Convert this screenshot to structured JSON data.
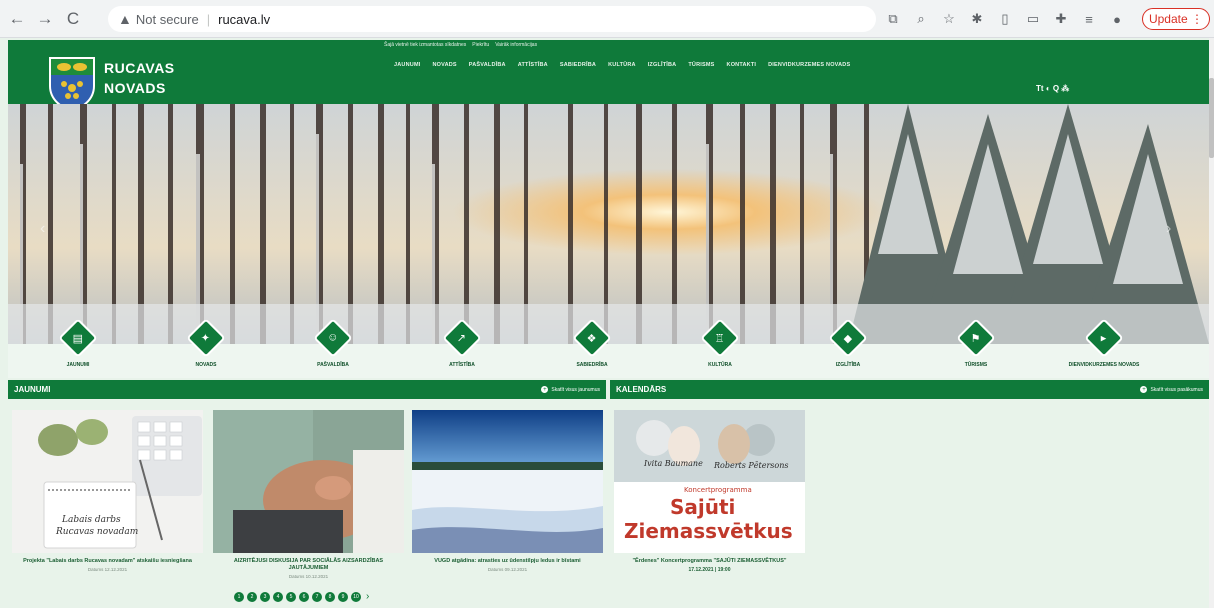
{
  "browser": {
    "security_label": "Not secure",
    "url": "rucava.lv",
    "update_label": "Update"
  },
  "site": {
    "topline": {
      "notice": "Šajā vietnē tiek izmantotas sīkdatnes",
      "accept": "Piekrītu",
      "more": "Vairāk informācijas"
    },
    "brand": {
      "line1": "RUCAVAS",
      "line2": "NOVADS"
    },
    "nav": [
      "JAUNUMI",
      "NOVADS",
      "PAŠVALDĪBA",
      "ATTĪSTĪBA",
      "SABIEDRĪBA",
      "KULTŪRA",
      "IZGLĪTĪBA",
      "TŪRISMS",
      "KONTAKTI",
      "DIENVIDKURZEMES NOVADS"
    ],
    "tools": "Tt ◐ Q ⁂"
  },
  "categories": [
    {
      "label": "JAUNUMI",
      "icon": "newspaper-icon",
      "glyph": "▤"
    },
    {
      "label": "NOVADS",
      "icon": "map-icon",
      "glyph": "✦"
    },
    {
      "label": "PAŠVALDĪBA",
      "icon": "people-icon",
      "glyph": "☺"
    },
    {
      "label": "ATTĪSTĪBA",
      "icon": "growth-icon",
      "glyph": "↗"
    },
    {
      "label": "SABIEDRĪBA",
      "icon": "community-icon",
      "glyph": "❖"
    },
    {
      "label": "KULTŪRA",
      "icon": "lantern-icon",
      "glyph": "♖"
    },
    {
      "label": "IZGLĪTĪBA",
      "icon": "graduation-cap-icon",
      "glyph": "◆"
    },
    {
      "label": "TŪRISMS",
      "icon": "lighthouse-icon",
      "glyph": "⚑"
    },
    {
      "label": "DIENVIDKURZEMES NOVADS",
      "icon": "flag-icon",
      "glyph": "▸"
    }
  ],
  "news": {
    "title": "JAUNUMI",
    "more": "Skatīt visus jaunumus",
    "items": [
      {
        "title": "Projekta \"Labais darbs Rucavas novadam\" atskaišu iesniegšana",
        "date": "Datums 12.12.2021"
      },
      {
        "title": "AIZRITĒJUSI DISKUSIJA PAR SOCIĀLĀS AIZSARDZĪBAS JAUTĀJUMIEM",
        "date": "Datums 10.12.2021"
      },
      {
        "title": "VUGD atgādina: atrasties uz ūdenstilpju ledus ir bīstami",
        "date": "Datums 09.12.2021"
      }
    ],
    "pages": [
      "1",
      "2",
      "3",
      "4",
      "5",
      "6",
      "7",
      "8",
      "9",
      "10"
    ],
    "next": "›"
  },
  "calendar": {
    "title": "KALENDĀRS",
    "more": "Skatīt visus pasākumus",
    "items": [
      {
        "title": "\"Ērdenes\" Koncertprogramma \"SAJŪTI ZIEMASSVĒTKUS\"",
        "date": "17.12.2021 | 19:00",
        "poster": {
          "name1": "Ivita Baumane",
          "name2": "Roberts Pētersons",
          "sub": "Koncertprogramma",
          "big1": "Sajūti",
          "big2": "Ziemassvētkus"
        }
      }
    ]
  },
  "colors": {
    "brand_green": "#0f7a3a",
    "page_bg": "#e8f3ea"
  }
}
